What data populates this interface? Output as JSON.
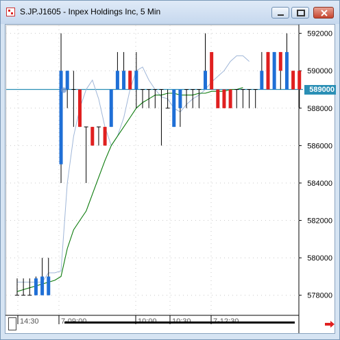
{
  "window": {
    "title": "S.JP.J1605 - Inpex Holdings Inc, 5 Min",
    "buttons": {
      "minimize": "minimize",
      "maximize": "maximize",
      "close": "close"
    }
  },
  "price_tag": "589000",
  "colors": {
    "up_bar": "#1f6fd6",
    "down_bar": "#e02020",
    "price_line": "#2a8fb5",
    "ma_long": "#0a7a0a",
    "ma_short": "#9fb6d8",
    "window_frame": "#d6e4f3"
  },
  "chart_data": {
    "type": "candlestick",
    "ylim": [
      577000,
      592500
    ],
    "y_ticks": [
      "592000",
      "590000",
      "588000",
      "586000",
      "584000",
      "582000",
      "580000",
      "578000"
    ],
    "x_ticks": [
      "14:30",
      "7-09:00",
      "10:00",
      "10:30",
      "7-12:30"
    ],
    "current_price": 589000,
    "bars": [
      {
        "o": 578000,
        "h": 578900,
        "l": 578000,
        "c": 578000
      },
      {
        "o": 578000,
        "h": 578900,
        "l": 578000,
        "c": 578000
      },
      {
        "o": 578000,
        "h": 578900,
        "l": 578000,
        "c": 578000
      },
      {
        "o": 578000,
        "h": 579000,
        "l": 578000,
        "c": 578900
      },
      {
        "o": 578000,
        "h": 580000,
        "l": 578000,
        "c": 579000
      },
      {
        "o": 578000,
        "h": 580000,
        "l": 578000,
        "c": 579000
      },
      null,
      {
        "o": 585000,
        "h": 592000,
        "l": 584000,
        "c": 590000
      },
      {
        "o": 589000,
        "h": 590000,
        "l": 588000,
        "c": 590000
      },
      {
        "o": 589000,
        "h": 590000,
        "l": 587000,
        "c": 589000
      },
      {
        "o": 589000,
        "h": 589000,
        "l": 587000,
        "c": 587000
      },
      {
        "o": 587000,
        "h": 587000,
        "l": 584000,
        "c": 587000
      },
      {
        "o": 587000,
        "h": 587000,
        "l": 586000,
        "c": 586000
      },
      {
        "o": 587000,
        "h": 587000,
        "l": 586000,
        "c": 587000
      },
      {
        "o": 587000,
        "h": 587000,
        "l": 586000,
        "c": 586000
      },
      {
        "o": 587000,
        "h": 589000,
        "l": 587000,
        "c": 589000
      },
      {
        "o": 589000,
        "h": 591000,
        "l": 589000,
        "c": 590000
      },
      {
        "o": 589000,
        "h": 591000,
        "l": 589000,
        "c": 590000
      },
      {
        "o": 590000,
        "h": 590000,
        "l": 589000,
        "c": 589000
      },
      {
        "o": 589000,
        "h": 591000,
        "l": 588000,
        "c": 590000
      },
      {
        "o": 589000,
        "h": 589000,
        "l": 588000,
        "c": 589000
      },
      {
        "o": 589000,
        "h": 589000,
        "l": 588000,
        "c": 589000
      },
      {
        "o": 589000,
        "h": 589000,
        "l": 588000,
        "c": 589000
      },
      {
        "o": 589000,
        "h": 589000,
        "l": 586000,
        "c": 589000
      },
      {
        "o": 588000,
        "h": 589000,
        "l": 588000,
        "c": 588000
      },
      {
        "o": 587000,
        "h": 589000,
        "l": 587000,
        "c": 589000
      },
      {
        "o": 588000,
        "h": 589000,
        "l": 587000,
        "c": 589000
      },
      {
        "o": 589000,
        "h": 589000,
        "l": 588000,
        "c": 589000
      },
      {
        "o": 589000,
        "h": 589000,
        "l": 588000,
        "c": 589000
      },
      {
        "o": 589000,
        "h": 589000,
        "l": 588000,
        "c": 589000
      },
      {
        "o": 589000,
        "h": 592000,
        "l": 589000,
        "c": 590000
      },
      {
        "o": 591000,
        "h": 591000,
        "l": 589000,
        "c": 589000
      },
      {
        "o": 589000,
        "h": 589000,
        "l": 588000,
        "c": 588000
      },
      {
        "o": 589000,
        "h": 589000,
        "l": 588000,
        "c": 588000
      },
      {
        "o": 589000,
        "h": 589000,
        "l": 588000,
        "c": 588000
      },
      {
        "o": 589000,
        "h": 589000,
        "l": 588000,
        "c": 589000
      },
      {
        "o": 589000,
        "h": 589000,
        "l": 588000,
        "c": 589000
      },
      {
        "o": 589000,
        "h": 589000,
        "l": 588000,
        "c": 589000
      },
      {
        "o": 589000,
        "h": 589000,
        "l": 588000,
        "c": 589000
      },
      {
        "o": 589000,
        "h": 591000,
        "l": 589000,
        "c": 590000
      },
      {
        "o": 591000,
        "h": 591000,
        "l": 589000,
        "c": 589000
      },
      {
        "o": 589000,
        "h": 591000,
        "l": 589000,
        "c": 591000
      },
      {
        "o": 591000,
        "h": 591000,
        "l": 589000,
        "c": 590000
      },
      {
        "o": 589000,
        "h": 592000,
        "l": 589000,
        "c": 591000
      },
      {
        "o": 590000,
        "h": 590000,
        "l": 589000,
        "c": 589000
      },
      {
        "o": 590000,
        "h": 590000,
        "l": 588000,
        "c": 589000
      }
    ],
    "ma_long": [
      578200,
      578300,
      578400,
      578500,
      578600,
      578700,
      578800,
      579000,
      580500,
      581500,
      582000,
      582500,
      583400,
      584300,
      585200,
      586000,
      586500,
      587000,
      587500,
      588000,
      588300,
      588500,
      588700,
      588700,
      588800,
      588800,
      588700,
      588700,
      588700,
      588800,
      588800,
      588900,
      588900,
      588900,
      589000,
      589000,
      589100
    ],
    "ma_short": [
      578700,
      578700,
      578700,
      578700,
      578700,
      579200,
      579200,
      579300,
      584000,
      586500,
      588000,
      589000,
      589500,
      588500,
      587000,
      586000,
      586500,
      587500,
      589000,
      590000,
      590200,
      589500,
      589000,
      588600,
      588500,
      588000,
      587800,
      588200,
      588500,
      588700,
      589000,
      589400,
      589700,
      590000,
      590500,
      590800,
      590800,
      590500
    ]
  }
}
